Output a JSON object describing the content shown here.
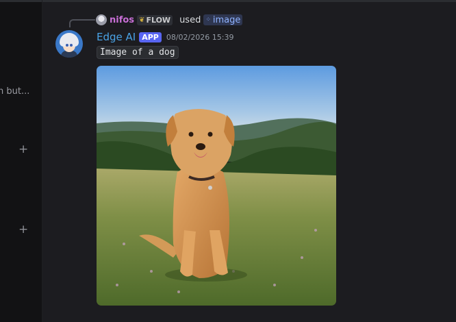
{
  "sidebar": {
    "truncated_text": "h but...",
    "plus_1": "+",
    "plus_2": "+"
  },
  "reply": {
    "user": "nifos",
    "tag": "FLOW",
    "verb": "used",
    "command": "image"
  },
  "message": {
    "author": "Edge AI",
    "badge": "APP",
    "timestamp": "08/02/2026 15:39",
    "content": "Image of a dog"
  },
  "icons": {
    "flow_tag": "leaf-icon",
    "command": "grid-icon",
    "add": "plus-icon"
  },
  "colors": {
    "author_name": "#4aa3e6",
    "reply_name": "#c86fd6",
    "app_badge": "#5865f2",
    "command_chip": "#2e3650"
  }
}
